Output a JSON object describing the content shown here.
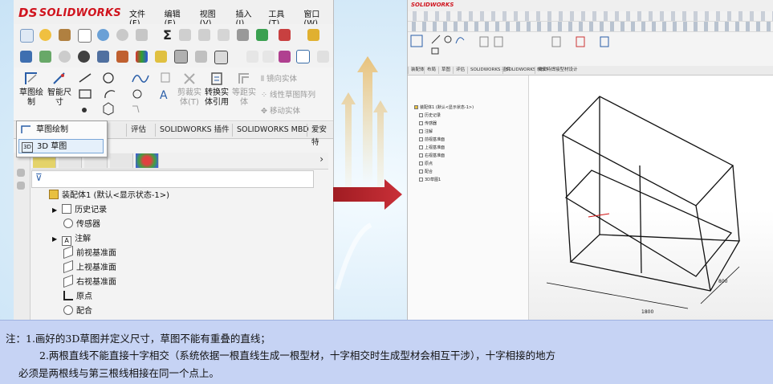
{
  "left_window": {
    "logo": {
      "ds": "DS",
      "name": "SOLIDWORKS"
    },
    "menu": [
      "文件(F)",
      "编辑(E)",
      "视图(V)",
      "插入(I)",
      "工具(T)",
      "窗口(W)"
    ],
    "toolbar_text": {
      "sigma": "Σ"
    },
    "command_buttons": [
      {
        "label": "草图绘\n制",
        "name": "sketch"
      },
      {
        "label": "智能尺\n寸",
        "name": "smart-dimension"
      },
      {
        "label": "剪裁实\n体(T)",
        "name": "trim-entities"
      },
      {
        "label": "转换实\n体引用",
        "name": "convert-entities"
      },
      {
        "label": "等距实\n体",
        "name": "offset-entities"
      }
    ],
    "side_commands": [
      "镜向实体",
      "线性草图阵列",
      "移动实体"
    ],
    "tabs": [
      "评估",
      "SOLIDWORKS 插件",
      "SOLIDWORKS MBD",
      "爱安特"
    ],
    "dropdown": {
      "items": [
        {
          "label": "草图绘制",
          "icon": "sketch-icon"
        },
        {
          "label": "3D 草图",
          "icon": "3d-sketch-icon",
          "badge": "3D"
        }
      ]
    },
    "tree": {
      "root": "装配体1  (默认<显示状态-1>)",
      "items": [
        {
          "label": "历史记录",
          "expandable": true,
          "icon": "history-icon"
        },
        {
          "label": "传感器",
          "expandable": false,
          "icon": "sensor-icon"
        },
        {
          "label": "注解",
          "expandable": true,
          "icon": "annotation-icon",
          "badge": "A"
        },
        {
          "label": "前视基准面",
          "expandable": false,
          "icon": "plane-icon"
        },
        {
          "label": "上视基准面",
          "expandable": false,
          "icon": "plane-icon"
        },
        {
          "label": "右视基准面",
          "expandable": false,
          "icon": "plane-icon"
        },
        {
          "label": "原点",
          "expandable": false,
          "icon": "origin-icon"
        },
        {
          "label": "配合",
          "expandable": false,
          "icon": "mate-icon"
        }
      ]
    }
  },
  "right_window": {
    "logo": "SOLIDWORKS",
    "tabs": [
      "装配体",
      "布局",
      "草图",
      "评估",
      "SOLIDWORKS 插件",
      "SOLIDWORKS MBD",
      "爱安特焊接型材设计"
    ],
    "tree": {
      "root": "装配体1 (默认<显示状态-1>)",
      "items": [
        "历史记录",
        "传感器",
        "注解",
        "前视基准面",
        "上视基准面",
        "右视基准面",
        "原点",
        "配合",
        "3D草图1"
      ]
    },
    "dimensions": [
      "1800",
      "800"
    ]
  },
  "note": {
    "line1": "注：1.画好的3D草图并定义尺寸，草图不能有重叠的直线；",
    "line2": "2.两根直线不能直接十字相交（系统依据一根直线生成一根型材，十字相交时生成型材会相互干涉），十字相接的地方",
    "line3": "必须是两根线与第三根线相接在同一个点上。"
  },
  "colors": {
    "accent_red": "#c0272d",
    "note_bg": "#c6d3f4",
    "logo_red": "#d0141e"
  }
}
